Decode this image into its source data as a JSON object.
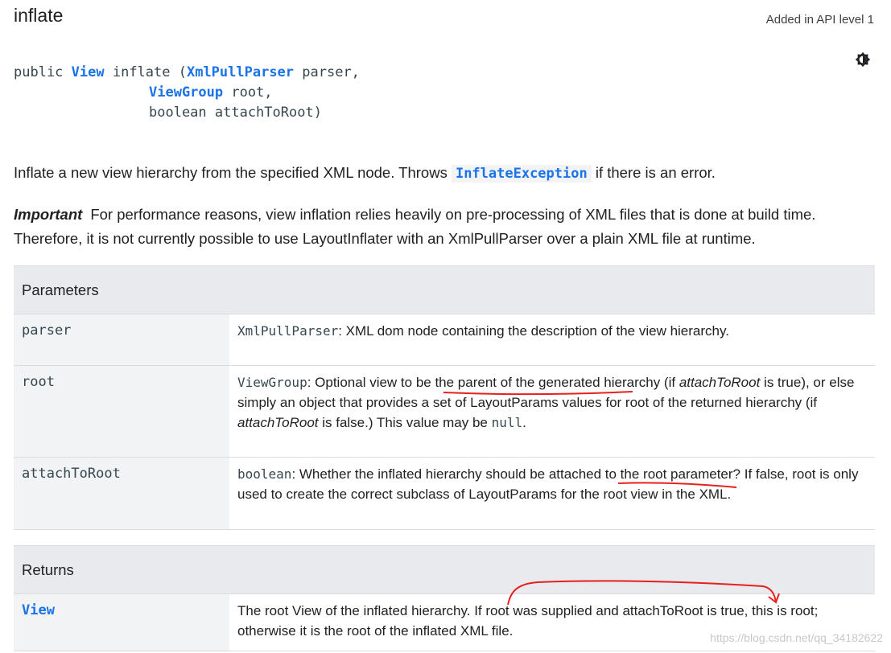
{
  "header": {
    "title": "inflate",
    "api_level": "Added in API level 1",
    "theme_icon": "brightness-icon"
  },
  "signature": {
    "line1_prefix": "public ",
    "return_type": "View",
    "line1_name": " inflate (",
    "param1_type": "XmlPullParser",
    "param1_name": " parser,",
    "param2_type": "ViewGroup",
    "param2_name": " root,",
    "param3": "boolean attachToRoot)"
  },
  "description": {
    "text_before": "Inflate a new view hierarchy from the specified XML node. Throws ",
    "exception": "InflateException",
    "text_after": " if there is an error.",
    "important_label": "Important",
    "important_text": "For performance reasons, view inflation relies heavily on pre-processing of XML files that is done at build time. Therefore, it is not currently possible to use LayoutInflater with an XmlPullParser over a plain XML file at runtime."
  },
  "parameters": {
    "header": "Parameters",
    "rows": [
      {
        "name": "parser",
        "type": "XmlPullParser",
        "text": ": XML dom node containing the description of the view hierarchy."
      },
      {
        "name": "root",
        "type": "ViewGroup",
        "text_a": ": Optional view to be the parent of the generated hierarchy (if ",
        "italic_a": "attachToRoot",
        "text_b": " is true), or else simply an object that provides a set of LayoutParams values for root of the returned hierarchy (if ",
        "italic_b": "attachToRoot",
        "text_c": " is false.) This value may be ",
        "null_code": "null",
        "text_d": "."
      },
      {
        "name": "attachToRoot",
        "type": "boolean",
        "text": ": Whether the inflated hierarchy should be attached to the root parameter? If false, root is only used to create the correct subclass of LayoutParams for the root view in the XML."
      }
    ]
  },
  "returns": {
    "header": "Returns",
    "type": "View",
    "text": "The root View of the inflated hierarchy. If root was supplied and attachToRoot is true, this is root; otherwise it is the root of the inflated XML file."
  },
  "watermark": "https://blog.csdn.net/qq_34182622",
  "colors": {
    "link": "#1a73e8",
    "annotation": "#e8201d",
    "table_header": "#e8eaed"
  }
}
